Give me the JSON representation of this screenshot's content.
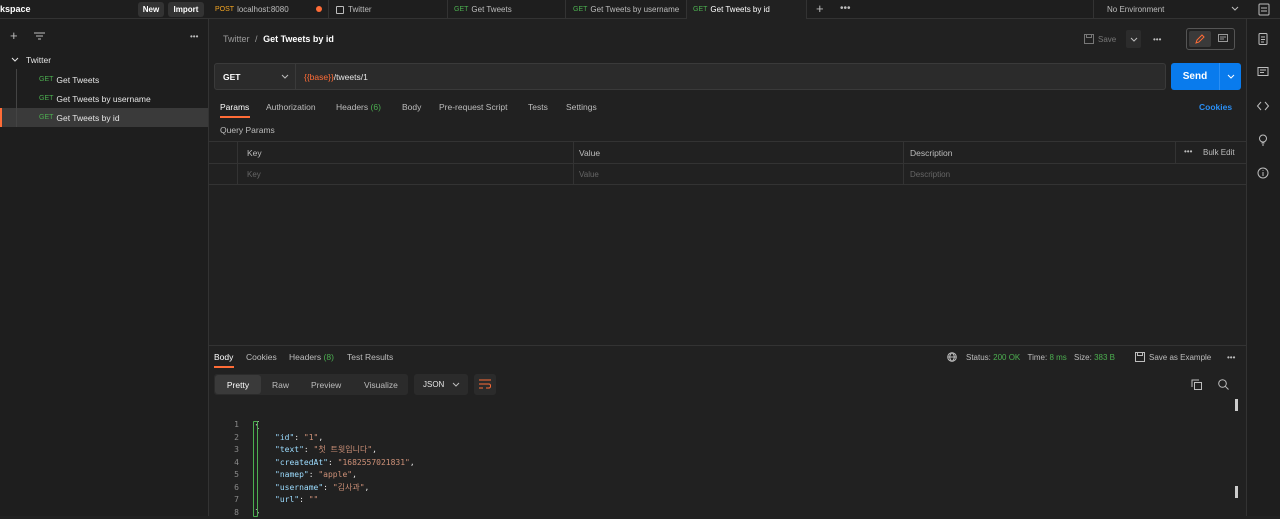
{
  "header": {
    "workspace": "kspace",
    "new_label": "New",
    "import_label": "Import",
    "environment": "No Environment"
  },
  "tabs": [
    {
      "method": "POST",
      "label": "localhost:8080",
      "unsaved": true
    },
    {
      "method": "",
      "label": "Twitter"
    },
    {
      "method": "GET",
      "label": "Get Tweets"
    },
    {
      "method": "GET",
      "label": "Get Tweets by username"
    },
    {
      "method": "GET",
      "label": "Get Tweets by id",
      "active": true
    }
  ],
  "sidebar": {
    "collection": "Twitter",
    "items": [
      {
        "method": "GET",
        "label": "Get Tweets"
      },
      {
        "method": "GET",
        "label": "Get Tweets by username"
      },
      {
        "method": "GET",
        "label": "Get Tweets by id",
        "active": true
      }
    ]
  },
  "breadcrumb": {
    "parent": "Twitter",
    "sep": "/",
    "current": "Get Tweets by id"
  },
  "toolbar": {
    "save_label": "Save"
  },
  "request": {
    "method": "GET",
    "url_var": "{{base}}",
    "url_path": "/tweets/1",
    "send_label": "Send"
  },
  "request_tabs": {
    "params": "Params",
    "authorization": "Authorization",
    "headers": "Headers",
    "headers_count": "(6)",
    "body": "Body",
    "prerequest": "Pre-request Script",
    "tests": "Tests",
    "settings": "Settings",
    "cookies": "Cookies"
  },
  "query_params": {
    "title": "Query Params",
    "col_key": "Key",
    "col_value": "Value",
    "col_description": "Description",
    "bulk_edit": "Bulk Edit",
    "ph_key": "Key",
    "ph_value": "Value",
    "ph_description": "Description"
  },
  "response": {
    "tabs": {
      "body": "Body",
      "cookies": "Cookies",
      "headers": "Headers",
      "headers_count": "(8)",
      "test_results": "Test Results"
    },
    "status_label": "Status:",
    "status": "200 OK",
    "time_label": "Time:",
    "time": "8 ms",
    "size_label": "Size:",
    "size": "383 B",
    "save_example": "Save as Example",
    "view_tabs": {
      "pretty": "Pretty",
      "raw": "Raw",
      "preview": "Preview",
      "visualize": "Visualize"
    },
    "format": "JSON",
    "lines": [
      {
        "n": "1",
        "text": "{"
      },
      {
        "n": "2",
        "k": "\"id\"",
        "v": "\"1\"",
        "c": ","
      },
      {
        "n": "3",
        "k": "\"text\"",
        "v": "\"첫 트윗입니다\"",
        "c": ","
      },
      {
        "n": "4",
        "k": "\"createdAt\"",
        "v": "\"1682557021831\"",
        "c": ","
      },
      {
        "n": "5",
        "k": "\"namep\"",
        "v": "\"apple\"",
        "c": ","
      },
      {
        "n": "6",
        "k": "\"username\"",
        "v": "\"김사과\"",
        "c": ","
      },
      {
        "n": "7",
        "k": "\"url\"",
        "v": "\"\"",
        "c": ""
      },
      {
        "n": "8",
        "text": "}"
      }
    ]
  },
  "colors": {
    "accent": "#ff6c37",
    "send": "#097bed",
    "get": "#4caf50",
    "post": "#f5a623",
    "var": "#ff6c37"
  }
}
